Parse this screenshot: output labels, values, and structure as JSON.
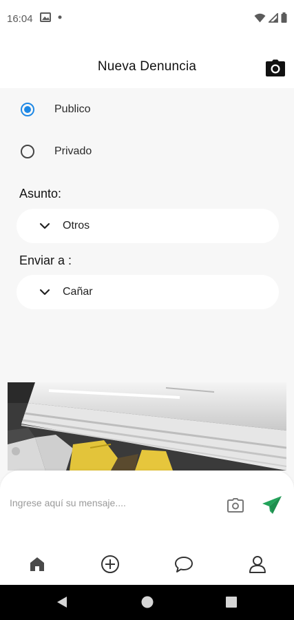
{
  "status_bar": {
    "time": "16:04"
  },
  "app_bar": {
    "title": "Nueva Denuncia"
  },
  "visibility": {
    "options": [
      {
        "label": "Publico",
        "selected": true
      },
      {
        "label": "Privado",
        "selected": false
      }
    ]
  },
  "asunto": {
    "label": "Asunto:",
    "value": "Otros"
  },
  "enviar": {
    "label": "Enviar a :",
    "value": "Cañar"
  },
  "compose": {
    "placeholder": "Ingrese aquí su mensaje...."
  },
  "colors": {
    "accent": "#1e88e5",
    "send": "#22a35a",
    "icon": "#333333"
  },
  "icons": [
    "camera-icon",
    "chevron-down-icon",
    "send-icon",
    "home-icon",
    "add-circle-icon",
    "chat-icon",
    "profile-icon"
  ]
}
